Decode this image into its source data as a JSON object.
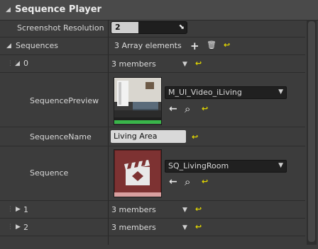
{
  "panel": {
    "title": "Sequence Player"
  },
  "screenshot_resolution": {
    "label": "Screenshot Resolution",
    "value": "2",
    "level": 0.36
  },
  "sequences": {
    "label": "Sequences",
    "summary": "3 Array elements"
  },
  "elements": [
    {
      "index": "0",
      "summary": "3 members"
    },
    {
      "index": "1",
      "summary": "3 members"
    },
    {
      "index": "2",
      "summary": "3 members"
    }
  ],
  "preview": {
    "label": "SequencePreview",
    "asset": "M_UI_Video_iLiving"
  },
  "name": {
    "label": "SequenceName",
    "value": "Living Area"
  },
  "sequence": {
    "label": "Sequence",
    "asset": "SQ_LivingRoom"
  },
  "icons": {
    "add": "+",
    "delete": "🗑",
    "reset": "↩",
    "use": "←",
    "browse": "⌕",
    "expand": "▶",
    "collapse": "◢",
    "dropdown": "▼",
    "resize": "⬊"
  },
  "colors": {
    "reset": "#e2d700",
    "background": "#3c3c3c",
    "header": "#4a4a4a"
  }
}
